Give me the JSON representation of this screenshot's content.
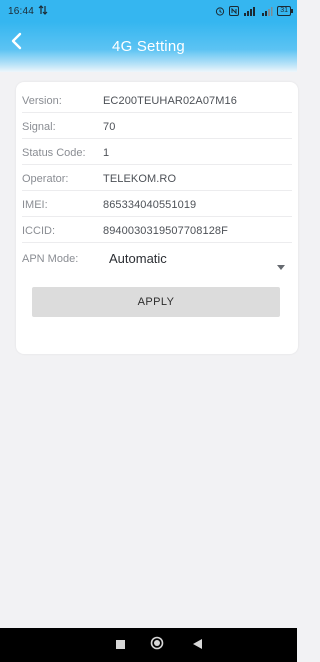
{
  "status_bar": {
    "time": "16:44",
    "battery": "31",
    "background_color": "#35b6f0"
  },
  "header": {
    "title": "4G Setting",
    "back_icon": "chevron-left-icon"
  },
  "info": {
    "rows": [
      {
        "label": "Version:",
        "value": "EC200TEUHAR02A07M16"
      },
      {
        "label": "Signal:",
        "value": "70"
      },
      {
        "label": "Status Code:",
        "value": "1"
      },
      {
        "label": "Operator:",
        "value": "TELEKOM.RO"
      },
      {
        "label": "IMEI:",
        "value": "865334040551019"
      },
      {
        "label": "ICCID:",
        "value": "8940030319507708128F"
      }
    ]
  },
  "apn": {
    "label": "APN Mode:",
    "selected": "Automatic"
  },
  "apply_label": "APPLY",
  "nav": {
    "icons": [
      "square-recents-icon",
      "circle-home-icon",
      "triangle-back-icon"
    ]
  }
}
